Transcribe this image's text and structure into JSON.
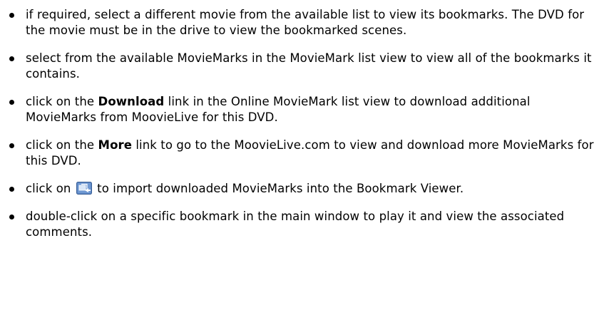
{
  "bullets": [
    {
      "text": "if required, select a different movie from the available list to view its bookmarks. The DVD for the movie must be in the drive to view the bookmarked scenes."
    },
    {
      "text": "select from the available MovieMarks in the MovieMark list view to view all of the bookmarks it contains."
    },
    {
      "before": "click on the ",
      "bold": "Download",
      "after": " link in the Online MovieMark list view to download additional MovieMarks from MoovieLive for this DVD."
    },
    {
      "before": "click on the ",
      "bold": "More",
      "after": " link to go to the MoovieLive.com to view and download more MovieMarks for this DVD."
    },
    {
      "before": "click on ",
      "icon": "import-moviemarks-icon",
      "after": " to import downloaded MovieMarks into the Bookmark Viewer."
    },
    {
      "text": "double-click on a specific bookmark in the main window to play it and view the associated comments."
    }
  ],
  "colors": {
    "text": "#000000",
    "icon_blue": "#4a78b8",
    "background": "#ffffff"
  }
}
